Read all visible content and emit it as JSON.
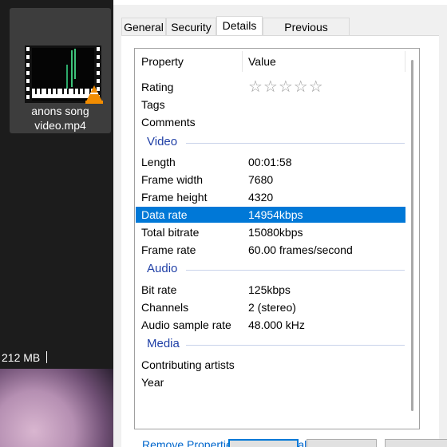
{
  "explorer": {
    "file_name_line1": "anons song",
    "file_name_line2": "video.mp4",
    "status_size": "212 MB"
  },
  "dialog": {
    "tabs": [
      "General",
      "Security",
      "Details",
      "Previous Versions"
    ],
    "active_tab": "Details",
    "columns": {
      "property": "Property",
      "value": "Value"
    },
    "rows_description": [
      {
        "property": "Rating",
        "value": "☆☆☆☆☆"
      },
      {
        "property": "Tags",
        "value": ""
      },
      {
        "property": "Comments",
        "value": ""
      }
    ],
    "group_video": "Video",
    "rows_video": [
      {
        "property": "Length",
        "value": "00:01:58"
      },
      {
        "property": "Frame width",
        "value": "7680"
      },
      {
        "property": "Frame height",
        "value": "4320"
      },
      {
        "property": "Data rate",
        "value": "14954kbps"
      },
      {
        "property": "Total bitrate",
        "value": "15080kbps"
      },
      {
        "property": "Frame rate",
        "value": "60.00 frames/second"
      }
    ],
    "selected_row": "Data rate",
    "group_audio": "Audio",
    "rows_audio": [
      {
        "property": "Bit rate",
        "value": "125kbps"
      },
      {
        "property": "Channels",
        "value": "2 (stereo)"
      },
      {
        "property": "Audio sample rate",
        "value": "48.000 kHz"
      }
    ],
    "group_media": "Media",
    "rows_media": [
      {
        "property": "Contributing artists",
        "value": ""
      },
      {
        "property": "Year",
        "value": ""
      }
    ],
    "remove_link": "Remove Properties and Personal Information"
  },
  "colors": {
    "selection": "#0078d7",
    "group_header": "#1f3fa6",
    "link": "#0066cc"
  }
}
